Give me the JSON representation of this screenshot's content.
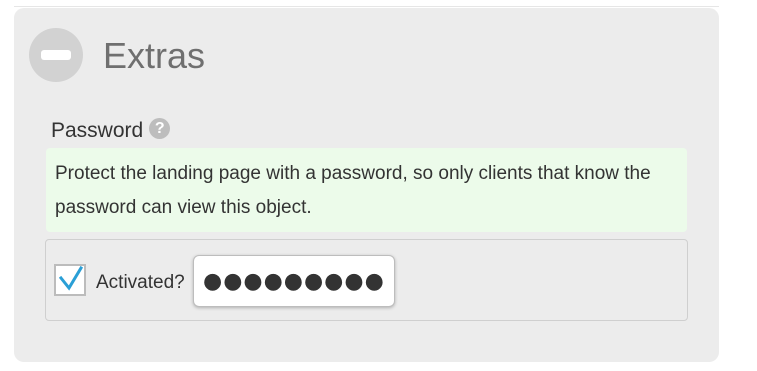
{
  "section": {
    "title": "Extras",
    "collapse_icon": "minus-circle-icon"
  },
  "password": {
    "label": "Password",
    "help_icon": "question-circle-icon",
    "help_glyph": "?",
    "description": "Protect the landing page with a password, so only clients that know the password can view this object.",
    "activated_label": "Activated?",
    "activated_checked": true,
    "masked_value": "●●●●●●●●●"
  },
  "colors": {
    "panel_bg": "#ececec",
    "info_bg": "#ecfbea",
    "check_accent": "#2a9fd6",
    "title_text": "#6f6f6f"
  }
}
